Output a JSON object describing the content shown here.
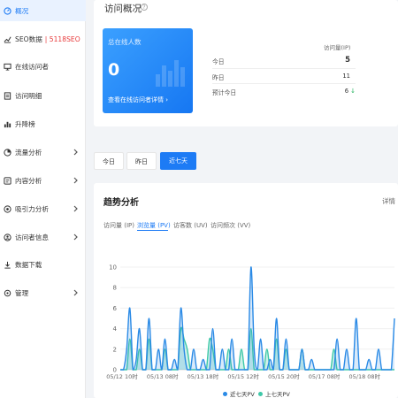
{
  "sidebar": {
    "items": [
      {
        "label": "概况",
        "icon": "dashboard-icon",
        "active": true
      },
      {
        "label": "SEO数据",
        "extra": "| 5118SEO",
        "icon": "line-chart-icon"
      },
      {
        "label": "在线访问者",
        "icon": "monitor-icon"
      },
      {
        "label": "访问明细",
        "icon": "document-icon"
      },
      {
        "label": "升降榜",
        "icon": "bar-chart-icon"
      },
      {
        "label": "流量分析",
        "icon": "traffic-icon",
        "expandable": true
      },
      {
        "label": "内容分析",
        "icon": "content-icon",
        "expandable": true
      },
      {
        "label": "吸引力分析",
        "icon": "attraction-icon",
        "expandable": true
      },
      {
        "label": "访问者信息",
        "icon": "user-info-icon",
        "expandable": true
      },
      {
        "label": "数据下载",
        "icon": "download-icon"
      },
      {
        "label": "管理",
        "icon": "gear-icon",
        "expandable": true
      }
    ]
  },
  "overview": {
    "title": "访问概况",
    "online": {
      "title": "总在线人数",
      "count": "0",
      "link": "查看在线访问者详情 ›"
    },
    "visit_header": "访问量(IP)",
    "rows": [
      {
        "label": "今日",
        "value": "5"
      },
      {
        "label": "昨日",
        "value": "11"
      },
      {
        "label": "预计今日",
        "value": "6",
        "trend": "↓"
      }
    ]
  },
  "date_tabs": [
    "今日",
    "昨日",
    "近七天"
  ],
  "trend": {
    "title": "趋势分析",
    "detail": "详情",
    "sub_tabs": [
      "访问量 (IP)",
      "浏览量 (PV)",
      "访客数 (UV)",
      "访问频次 (VV)"
    ]
  },
  "colors": {
    "accent": "#1d7bf5",
    "current": "#2a8ae6",
    "previous": "#3ec8a8"
  },
  "chart_data": {
    "type": "area",
    "x_tick_labels": [
      "05/12 10时",
      "05/13 08时",
      "05/13 18时",
      "05/15 12时",
      "05/15 20时",
      "05/17 08时",
      "05/18 08时"
    ],
    "ylim": [
      0,
      10
    ],
    "y_ticks": [
      0,
      2,
      4,
      6,
      8,
      10
    ],
    "series": [
      {
        "name": "近七天PV",
        "color": "#2a8ae6",
        "values": [
          0,
          0,
          2,
          6,
          0,
          1,
          4,
          0,
          0,
          5,
          0,
          0,
          2,
          0,
          3,
          0,
          0,
          1,
          0,
          6,
          2,
          0,
          0,
          2,
          0,
          0,
          1,
          0,
          0,
          4,
          0,
          0,
          2,
          0,
          0,
          3,
          0,
          0,
          0,
          0,
          0,
          10,
          2,
          0,
          3,
          0,
          0,
          1,
          0,
          5,
          0,
          0,
          3,
          0,
          0,
          0,
          0,
          2,
          0,
          0,
          1,
          0,
          0,
          0,
          0,
          0,
          0,
          0,
          3,
          0,
          0,
          2,
          0,
          0,
          5,
          0,
          0,
          0,
          1,
          0,
          0,
          2,
          0,
          0,
          0,
          0,
          5
        ]
      },
      {
        "name": "上七天PV",
        "color": "#3ec8a8",
        "values": [
          0,
          0,
          0,
          3,
          0,
          0,
          2,
          0,
          0,
          3,
          0,
          0,
          0,
          0,
          2,
          0,
          0,
          0,
          0,
          4,
          3,
          2,
          0,
          0,
          0,
          0,
          0,
          0,
          3,
          2,
          0,
          0,
          0,
          0,
          2,
          0,
          0,
          0,
          2,
          0,
          0,
          4,
          0,
          0,
          0,
          0,
          2,
          0,
          0,
          3,
          0,
          0,
          2,
          0,
          0,
          0,
          0,
          2,
          0,
          0,
          0,
          0,
          0,
          0,
          0,
          0,
          0,
          2,
          0,
          0,
          0,
          0,
          0,
          0,
          0,
          0,
          0,
          0,
          0,
          0,
          0,
          0,
          0,
          0,
          0,
          0,
          0
        ]
      }
    ],
    "legend": "bottom-center"
  }
}
